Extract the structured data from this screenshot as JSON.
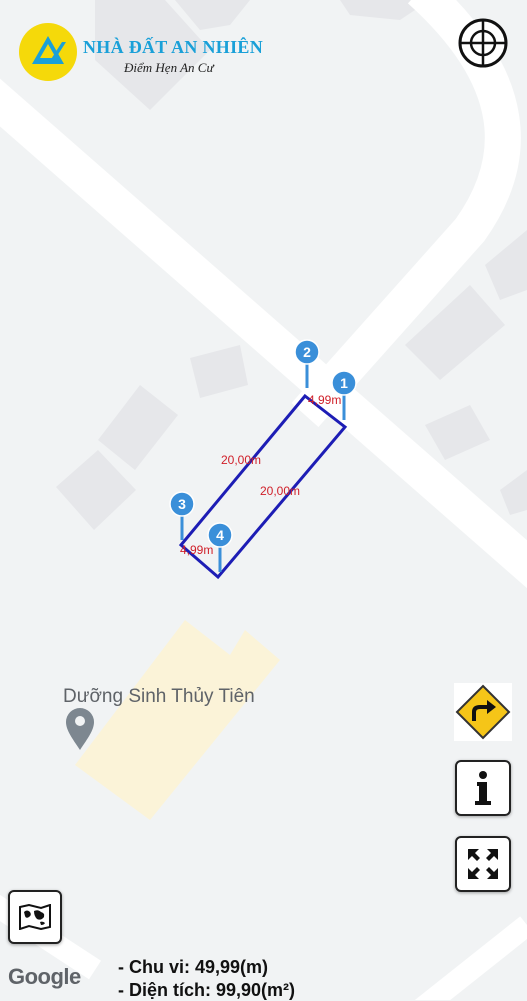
{
  "brand": {
    "name": "NHÀ ĐẤT AN NHIÊN",
    "slogan": "Điểm Hẹn An Cư",
    "logo_letter": "A",
    "logo_colors": {
      "circle": "#f5d90a",
      "mark": "#1aa0d8"
    }
  },
  "map": {
    "poi": {
      "name": "Dưỡng Sinh Thủy Tiên",
      "icon": "place-pin-icon"
    },
    "attribution": "Google",
    "colors": {
      "background": "#f1f3f4",
      "road": "#ffffff",
      "building": "#e6e7ea",
      "poi_area": "#fbf3d8",
      "parcel": "#1d1db5",
      "dimension_text": "#d0202a",
      "marker": "#3a8fd9"
    }
  },
  "parcel": {
    "markers": [
      "1",
      "2",
      "3",
      "4"
    ],
    "edge_labels": [
      "4,99m",
      "20,00m",
      "20,00m",
      "4,99m"
    ]
  },
  "info": {
    "perimeter": "- Chu vi: 49,99(m)",
    "area": "- Diện tích: 99,90(m²)"
  },
  "controls": {
    "locate": "crosshair-icon",
    "directions": "turn-right-sign-icon",
    "info": "info-icon",
    "fullscreen": "fullscreen-icon",
    "map_type": "world-map-icon"
  }
}
